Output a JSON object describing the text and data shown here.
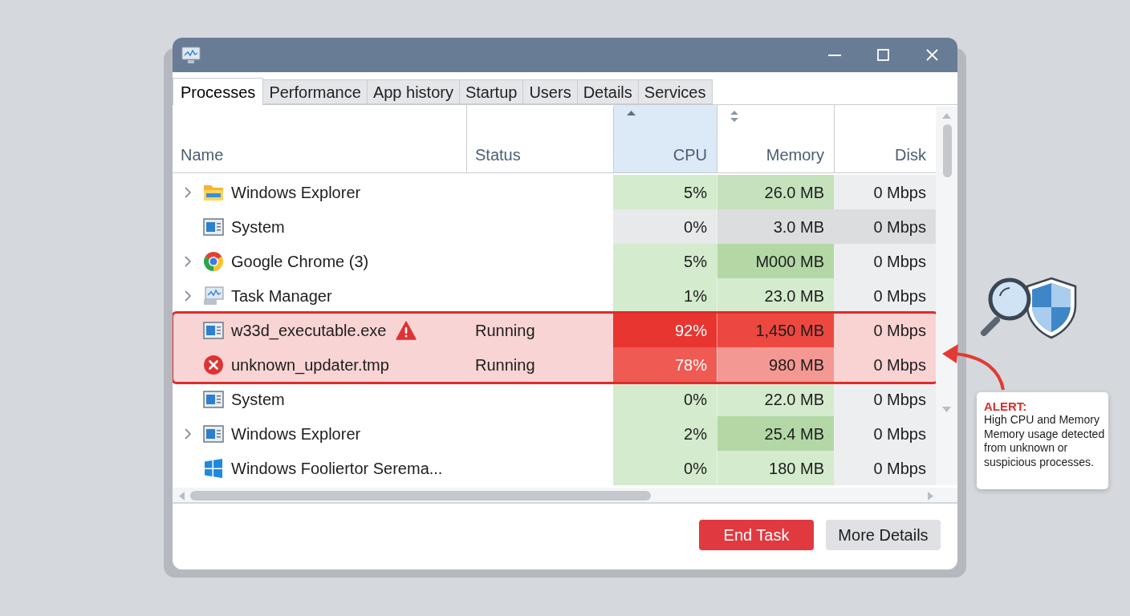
{
  "tabs": [
    {
      "label": "Processes",
      "selected": true
    },
    {
      "label": "Performance",
      "selected": false
    },
    {
      "label": "App history",
      "selected": false
    },
    {
      "label": "Startup",
      "selected": false
    },
    {
      "label": "Users",
      "selected": false
    },
    {
      "label": "Details",
      "selected": false
    },
    {
      "label": "Services",
      "selected": false
    }
  ],
  "columns": [
    {
      "label": "Name",
      "kind": "plain"
    },
    {
      "label": "Status",
      "kind": "plain"
    },
    {
      "label": "CPU",
      "kind": "sorted"
    },
    {
      "label": "Memory",
      "kind": "sortable"
    },
    {
      "label": "Disk",
      "kind": "plain"
    }
  ],
  "rows": [
    {
      "kind": "folder",
      "expandable": true,
      "alert": false,
      "name": "Windows Explorer",
      "cpu": {
        "text": "5%",
        "color": "#d4ebce"
      },
      "memory": {
        "text": "26.0 MB",
        "color": "#c6e2bd"
      },
      "disk": {
        "text": "0 Mbps",
        "color": "#eceef0"
      }
    },
    {
      "kind": "app",
      "expandable": false,
      "alert": false,
      "name": "System",
      "cpu": {
        "text": "0%",
        "color": "#e8e9ea"
      },
      "memory": {
        "text": "3.0 MB",
        "color": "#dcdddf"
      },
      "disk": {
        "text": "0 Mbps",
        "color": "#dcdddf"
      }
    },
    {
      "kind": "browser",
      "expandable": true,
      "alert": false,
      "name": "Google Chrome (3)",
      "cpu": {
        "text": "5%",
        "color": "#d4ebce"
      },
      "memory": {
        "text": "M000 MB",
        "color": "#b3d8a6"
      },
      "disk": {
        "text": "0 Mbps",
        "color": "#eceef0"
      }
    },
    {
      "kind": "monitor",
      "expandable": true,
      "alert": false,
      "name": "Task Manager",
      "cpu": {
        "text": "1%",
        "color": "#d4ebce"
      },
      "memory": {
        "text": "23.0 MB",
        "color": "#d4ebce"
      },
      "disk": {
        "text": "0 Mbps",
        "color": "#eceef0"
      }
    },
    {
      "kind": "app",
      "expandable": false,
      "alert": true,
      "name": "w33d_executable.exe",
      "warning": true,
      "status": "Running",
      "cpu": {
        "text": "92%",
        "color": "#e8352f"
      },
      "memory": {
        "text": "1,450 MB",
        "color": "#ec4840"
      },
      "disk": {
        "text": "0 Mbps",
        "color": "#f8d3d2"
      }
    },
    {
      "kind": "error",
      "expandable": false,
      "alert": true,
      "name": "unknown_updater.tmp",
      "status": "Running",
      "cpu": {
        "text": "78%",
        "color": "#ef5a53"
      },
      "memory": {
        "text": "980 MB",
        "color": "#f49893"
      },
      "disk": {
        "text": "0 Mbps",
        "color": "#f8d3d2"
      }
    },
    {
      "kind": "app",
      "expandable": false,
      "alert": false,
      "name": "System",
      "cpu": {
        "text": "0%",
        "color": "#d4ebce"
      },
      "memory": {
        "text": "22.0 MB",
        "color": "#d4ebce"
      },
      "disk": {
        "text": "0 Mbps",
        "color": "#eceef0"
      }
    },
    {
      "kind": "app",
      "expandable": true,
      "alert": false,
      "name": "Windows Explorer",
      "cpu": {
        "text": "2%",
        "color": "#d4ebce"
      },
      "memory": {
        "text": "25.4 MB",
        "color": "#b3d8a6"
      },
      "disk": {
        "text": "0 Mbps",
        "color": "#eceef0"
      }
    },
    {
      "kind": "windows",
      "expandable": false,
      "alert": false,
      "name": "Windows Fooliertor Serema...",
      "cpu": {
        "text": "0%",
        "color": "#d4ebce"
      },
      "memory": {
        "text": "180 MB",
        "color": "#d4ebce"
      },
      "disk": {
        "text": "0 Mbps",
        "color": "#eceef0"
      }
    }
  ],
  "buttons": [
    {
      "label": "End Task",
      "kind": "danger"
    },
    {
      "label": "More Details",
      "kind": "default"
    }
  ],
  "alert": {
    "title": "ALERT:",
    "message": "High CPU and Memory Memory usage detected from unknown or suspicious processes."
  }
}
